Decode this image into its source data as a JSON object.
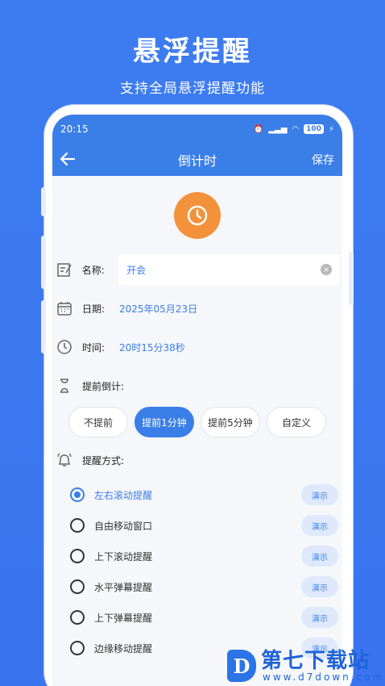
{
  "promo": {
    "title": "悬浮提醒",
    "subtitle": "支持全局悬浮提醒功能"
  },
  "status_bar": {
    "time": "20:15",
    "battery": "100"
  },
  "app_bar": {
    "back_icon": "arrow-left-icon",
    "title": "倒计时",
    "save_label": "保存"
  },
  "form": {
    "name_label": "名称:",
    "name_value": "开会",
    "date_label": "日期:",
    "date_value": "2025年05月23日",
    "time_label": "时间:",
    "time_value": "20时15分38秒",
    "advance_label": "提前倒计:",
    "advance_options": [
      "不提前",
      "提前1分钟",
      "提前5分钟",
      "自定义"
    ],
    "advance_selected": "提前1分钟",
    "mode_label": "提醒方式:",
    "demo_label": "演示",
    "modes": [
      "左右滚动提醒",
      "自由移动窗口",
      "上下滚动提醒",
      "水平弹幕提醒",
      "上下弹幕提醒",
      "边缘移动提醒"
    ],
    "mode_selected": "左右滚动提醒"
  },
  "watermark": {
    "logo_letter": "D",
    "name": "第七下载站",
    "url": "www.d7down.com"
  },
  "colors": {
    "accent": "#3a7ee8",
    "clock": "#f3923b",
    "background": "#3d7cf0"
  }
}
